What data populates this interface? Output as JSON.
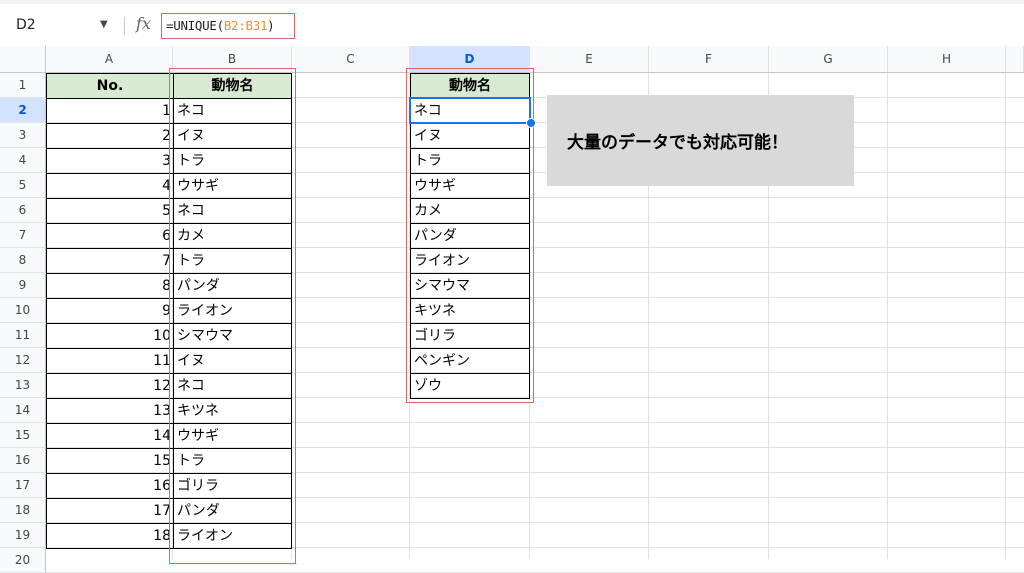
{
  "name_box": "D2",
  "formula": {
    "prefix": "=UNIQUE(",
    "range": "B2:B31",
    "suffix": ")"
  },
  "fx_label": "fx",
  "columns": [
    "A",
    "B",
    "C",
    "D",
    "E",
    "F",
    "G",
    "H"
  ],
  "rows": [
    "1",
    "2",
    "3",
    "4",
    "5",
    "6",
    "7",
    "8",
    "9",
    "10",
    "11",
    "12",
    "13",
    "14",
    "15",
    "16",
    "17",
    "18",
    "19",
    "20"
  ],
  "source_table": {
    "headers": [
      "No.",
      "動物名"
    ],
    "rows": [
      [
        "1",
        "ネコ"
      ],
      [
        "2",
        "イヌ"
      ],
      [
        "3",
        "トラ"
      ],
      [
        "4",
        "ウサギ"
      ],
      [
        "5",
        "ネコ"
      ],
      [
        "6",
        "カメ"
      ],
      [
        "7",
        "トラ"
      ],
      [
        "8",
        "パンダ"
      ],
      [
        "9",
        "ライオン"
      ],
      [
        "10",
        "シマウマ"
      ],
      [
        "11",
        "イヌ"
      ],
      [
        "12",
        "ネコ"
      ],
      [
        "13",
        "キツネ"
      ],
      [
        "14",
        "ウサギ"
      ],
      [
        "15",
        "トラ"
      ],
      [
        "16",
        "ゴリラ"
      ],
      [
        "17",
        "パンダ"
      ],
      [
        "18",
        "ライオン"
      ]
    ]
  },
  "unique_table": {
    "header": "動物名",
    "values": [
      "ネコ",
      "イヌ",
      "トラ",
      "ウサギ",
      "カメ",
      "パンダ",
      "ライオン",
      "シマウマ",
      "キツネ",
      "ゴリラ",
      "ペンギン",
      "ゾウ"
    ]
  },
  "note": "大量のデータでも対応可能！",
  "colors": {
    "header_fill": "#d9ead3",
    "highlight_border": "#e06666",
    "selection": "#1a73e8",
    "note_fill": "#d9d9d9"
  }
}
